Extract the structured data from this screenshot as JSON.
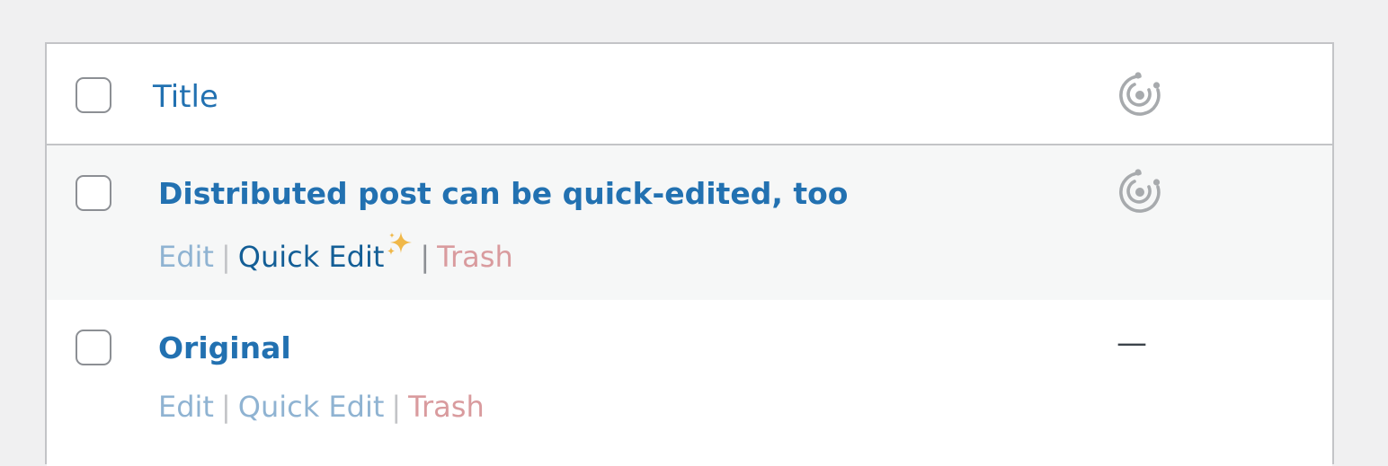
{
  "table": {
    "header": {
      "title_label": "Title",
      "status_icon": "distributor-orbit-icon"
    },
    "rows": [
      {
        "title": "Distributed post can be quick-edited, too",
        "actions": {
          "edit": "Edit",
          "quick_edit": "Quick Edit",
          "trash": "Trash",
          "separator": "|"
        },
        "quick_edit_icon": "sparkles-icon",
        "status_icon": "distributor-orbit-icon"
      },
      {
        "title": "Original",
        "actions": {
          "edit": "Edit",
          "quick_edit": "Quick Edit",
          "trash": "Trash",
          "separator": "|"
        },
        "status_text": "—"
      }
    ]
  },
  "colors": {
    "link": "#2271b1",
    "trash": "#d63638",
    "border": "#c3c4c7",
    "icon_gray": "#a7aaad",
    "sparkle": "#f0b849"
  }
}
